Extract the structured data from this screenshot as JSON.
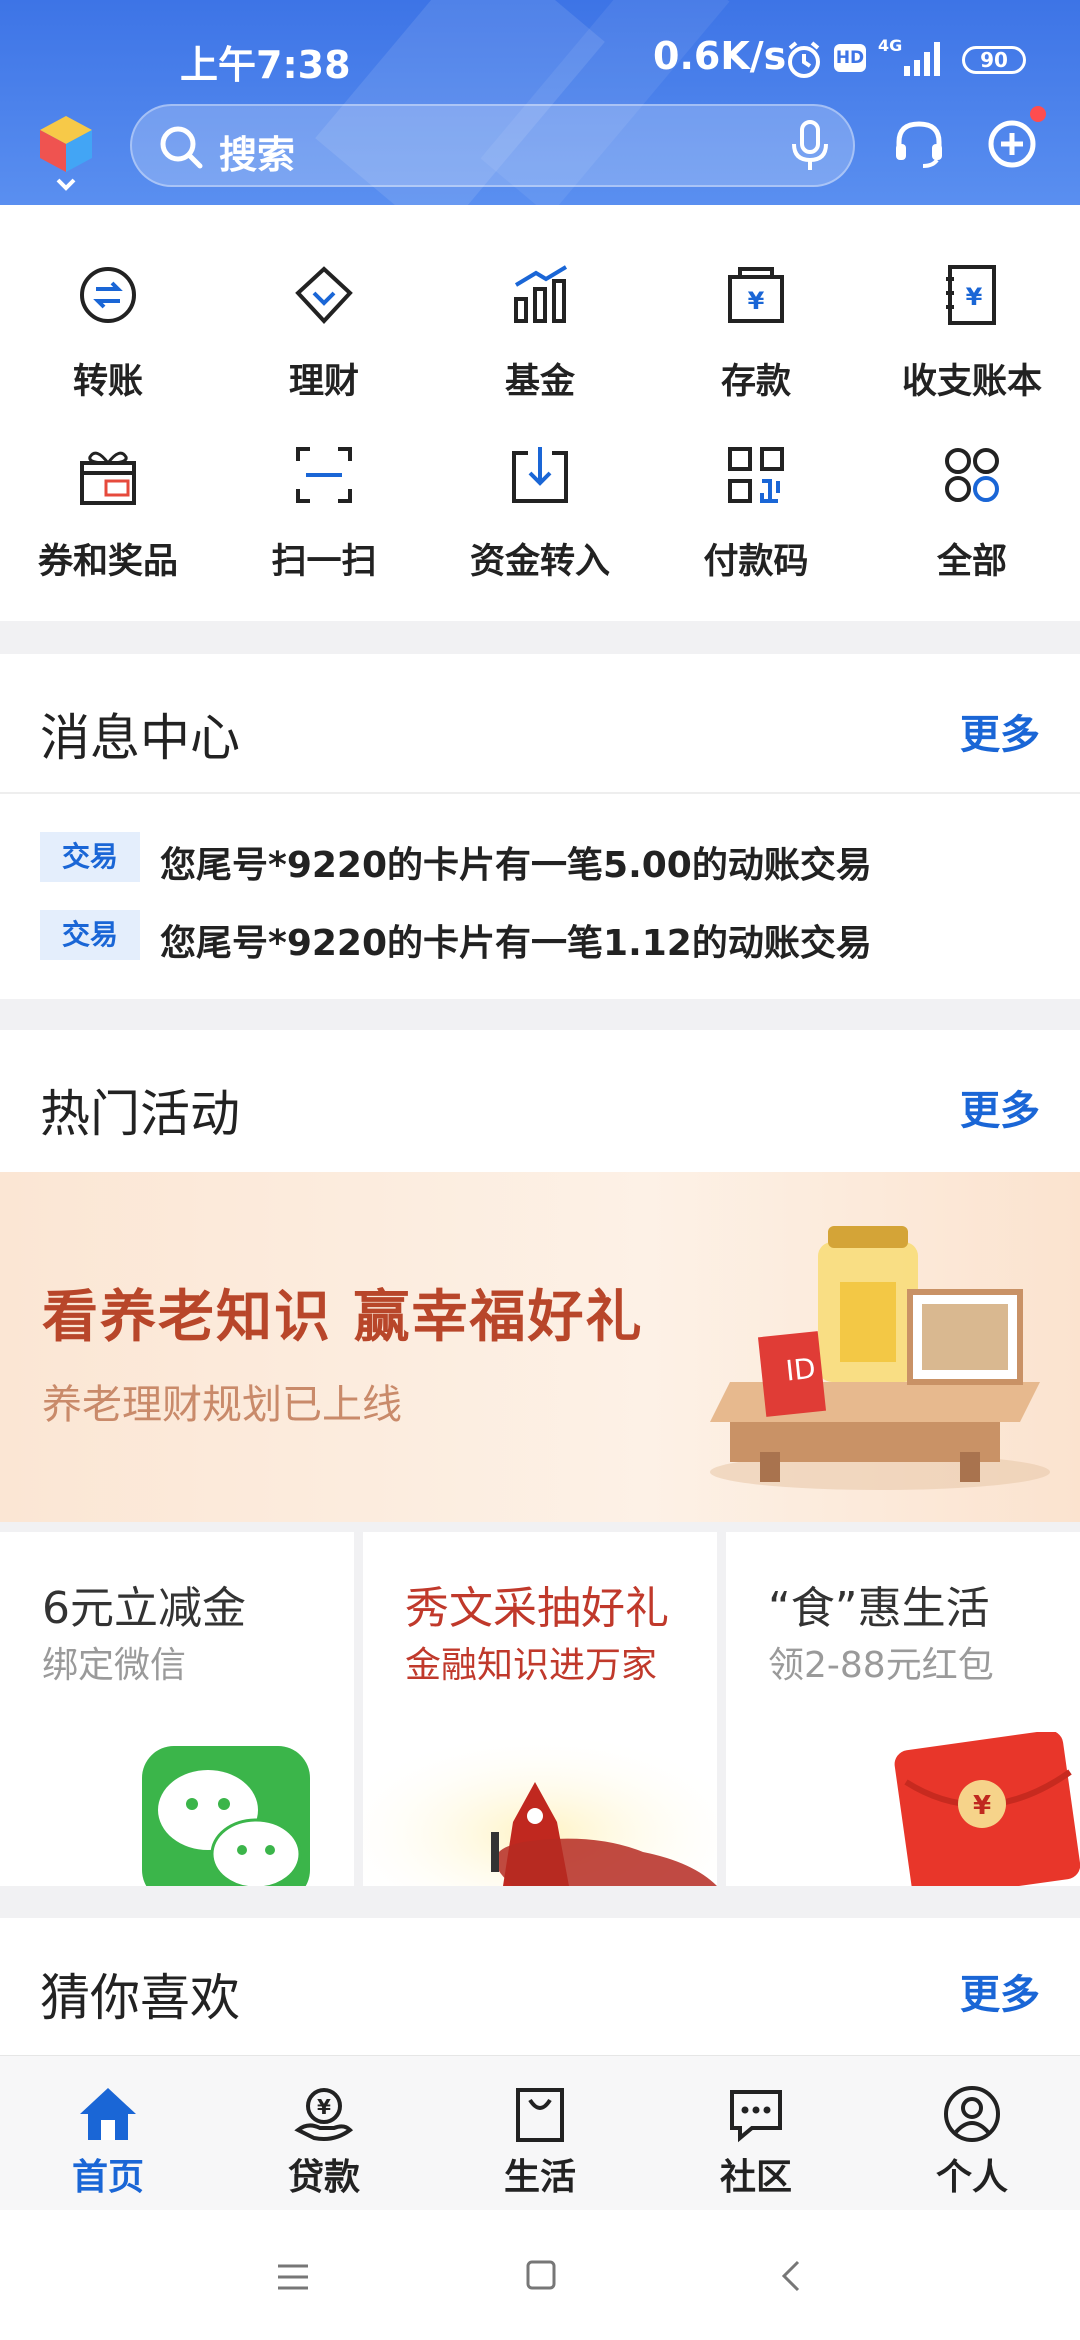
{
  "status_bar": {
    "time": "上午7:38",
    "net_speed": "0.6K/s",
    "battery": "90",
    "network": "4G"
  },
  "header": {
    "search_label": "搜索",
    "colors": {
      "bg_top": "#3d74e6",
      "bg_bottom": "#5a8ff0"
    }
  },
  "quick_actions": [
    {
      "label": "转账",
      "icon": "transfer-icon"
    },
    {
      "label": "理财",
      "icon": "diamond-icon"
    },
    {
      "label": "基金",
      "icon": "bar-chart-icon"
    },
    {
      "label": "存款",
      "icon": "deposit-box-icon"
    },
    {
      "label": "收支账本",
      "icon": "ledger-icon"
    },
    {
      "label": "券和奖品",
      "icon": "gift-coupon-icon"
    },
    {
      "label": "扫一扫",
      "icon": "scan-icon"
    },
    {
      "label": "资金转入",
      "icon": "fund-in-icon"
    },
    {
      "label": "付款码",
      "icon": "qr-code-icon"
    },
    {
      "label": "全部",
      "icon": "all-apps-icon"
    }
  ],
  "message_center": {
    "title": "消息中心",
    "more": "更多",
    "messages": [
      {
        "tag": "交易",
        "text": "您尾号*9220的卡片有一笔5.00的动账交易"
      },
      {
        "tag": "交易",
        "text": "您尾号*9220的卡片有一笔1.12的动账交易"
      }
    ]
  },
  "hot_activities": {
    "title": "热门活动",
    "more": "更多",
    "banner": {
      "title": "看养老知识 赢幸福好礼",
      "subtitle": "养老理财规划已上线",
      "badge": "ID"
    },
    "cards": [
      {
        "title": "6元立减金",
        "subtitle": "绑定微信"
      },
      {
        "title": "秀文采抽好礼",
        "subtitle": "金融知识进万家"
      },
      {
        "title": "“食”惠生活",
        "subtitle": "领2-88元红包"
      }
    ]
  },
  "guess_you_like": {
    "title": "猜你喜欢",
    "more": "更多"
  },
  "bottom_nav": [
    {
      "label": "首页",
      "icon": "home-icon",
      "active": true
    },
    {
      "label": "贷款",
      "icon": "loan-icon",
      "active": false
    },
    {
      "label": "生活",
      "icon": "shopping-bag-icon",
      "active": false
    },
    {
      "label": "社区",
      "icon": "chat-bubble-icon",
      "active": false
    },
    {
      "label": "个人",
      "icon": "user-icon",
      "active": false
    }
  ],
  "accent_color": "#1a66d6"
}
